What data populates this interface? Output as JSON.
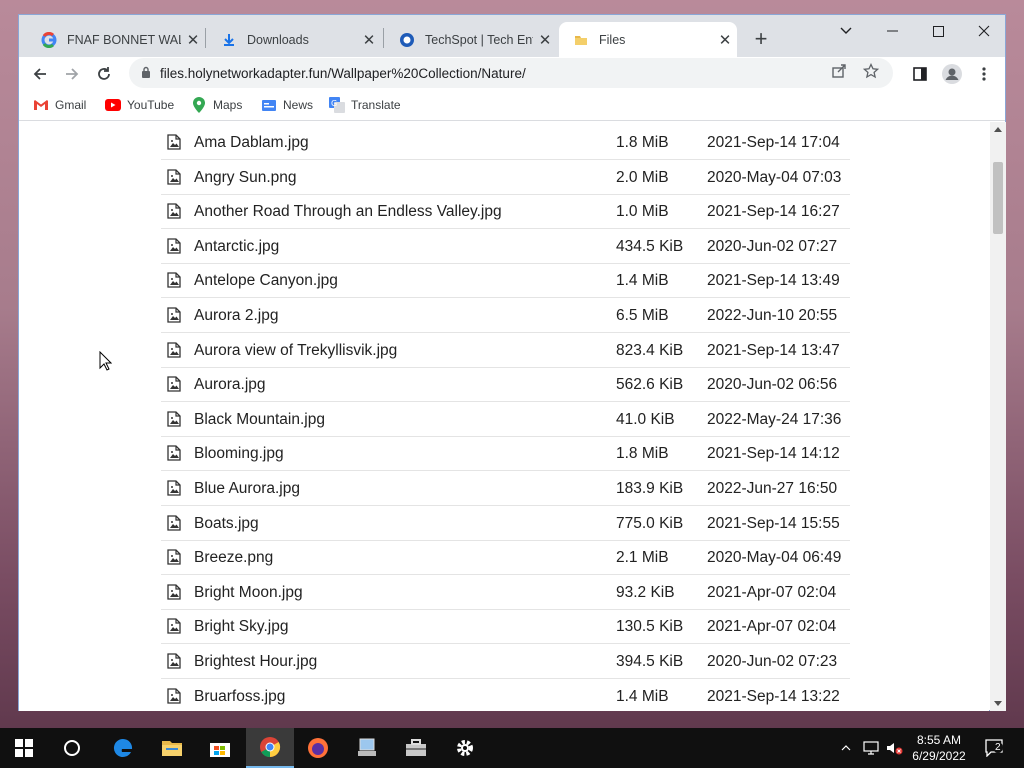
{
  "browser": {
    "tabs": [
      {
        "title": "FNAF BONNET WALL",
        "favicon": "google-icon",
        "active": false
      },
      {
        "title": "Downloads",
        "favicon": "download-icon",
        "active": false
      },
      {
        "title": "TechSpot | Tech Enth",
        "favicon": "techspot-icon",
        "active": false
      },
      {
        "title": "Files",
        "favicon": "folder-icon",
        "active": true
      }
    ],
    "url": "files.holynetworkadapter.fun/Wallpaper%20Collection/Nature/",
    "bookmarks": [
      {
        "label": "Gmail",
        "icon": "gmail-icon"
      },
      {
        "label": "YouTube",
        "icon": "youtube-icon"
      },
      {
        "label": "Maps",
        "icon": "maps-icon"
      },
      {
        "label": "News",
        "icon": "news-icon"
      },
      {
        "label": "Translate",
        "icon": "translate-icon"
      }
    ]
  },
  "files": [
    {
      "name": "Ama Dablam.jpg",
      "size": "1.8 MiB",
      "date": "2021-Sep-14 17:04"
    },
    {
      "name": "Angry Sun.png",
      "size": "2.0 MiB",
      "date": "2020-May-04 07:03"
    },
    {
      "name": "Another Road Through an Endless Valley.jpg",
      "size": "1.0 MiB",
      "date": "2021-Sep-14 16:27"
    },
    {
      "name": "Antarctic.jpg",
      "size": "434.5 KiB",
      "date": "2020-Jun-02 07:27"
    },
    {
      "name": "Antelope Canyon.jpg",
      "size": "1.4 MiB",
      "date": "2021-Sep-14 13:49"
    },
    {
      "name": "Aurora 2.jpg",
      "size": "6.5 MiB",
      "date": "2022-Jun-10 20:55"
    },
    {
      "name": "Aurora view of Trekyllisvik.jpg",
      "size": "823.4 KiB",
      "date": "2021-Sep-14 13:47"
    },
    {
      "name": "Aurora.jpg",
      "size": "562.6 KiB",
      "date": "2020-Jun-02 06:56"
    },
    {
      "name": "Black Mountain.jpg",
      "size": "41.0 KiB",
      "date": "2022-May-24 17:36"
    },
    {
      "name": "Blooming.jpg",
      "size": "1.8 MiB",
      "date": "2021-Sep-14 14:12"
    },
    {
      "name": "Blue Aurora.jpg",
      "size": "183.9 KiB",
      "date": "2022-Jun-27 16:50"
    },
    {
      "name": "Boats.jpg",
      "size": "775.0 KiB",
      "date": "2021-Sep-14 15:55"
    },
    {
      "name": "Breeze.png",
      "size": "2.1 MiB",
      "date": "2020-May-04 06:49"
    },
    {
      "name": "Bright Moon.jpg",
      "size": "93.2 KiB",
      "date": "2021-Apr-07 02:04"
    },
    {
      "name": "Bright Sky.jpg",
      "size": "130.5 KiB",
      "date": "2021-Apr-07 02:04"
    },
    {
      "name": "Brightest Hour.jpg",
      "size": "394.5 KiB",
      "date": "2020-Jun-02 07:23"
    },
    {
      "name": "Bruarfoss.jpg",
      "size": "1.4 MiB",
      "date": "2021-Sep-14 13:22"
    }
  ],
  "taskbar": {
    "apps": [
      {
        "icon": "windows-start-icon"
      },
      {
        "icon": "cortana-search-icon"
      },
      {
        "icon": "edge-icon"
      },
      {
        "icon": "file-explorer-icon"
      },
      {
        "icon": "microsoft-store-icon"
      },
      {
        "icon": "chrome-icon",
        "active": true
      },
      {
        "icon": "firefox-icon"
      },
      {
        "icon": "computer-app-icon"
      },
      {
        "icon": "toolbox-app-icon"
      },
      {
        "icon": "settings-gear-icon"
      }
    ],
    "clock": {
      "time": "8:55 AM",
      "date": "6/29/2022"
    },
    "notification_count": "2"
  },
  "colors": {
    "taskbar": "#101010",
    "tabstrip": "#dee1e6",
    "omnibox": "#f1f3f4",
    "window_border": "#8aa6d6"
  }
}
